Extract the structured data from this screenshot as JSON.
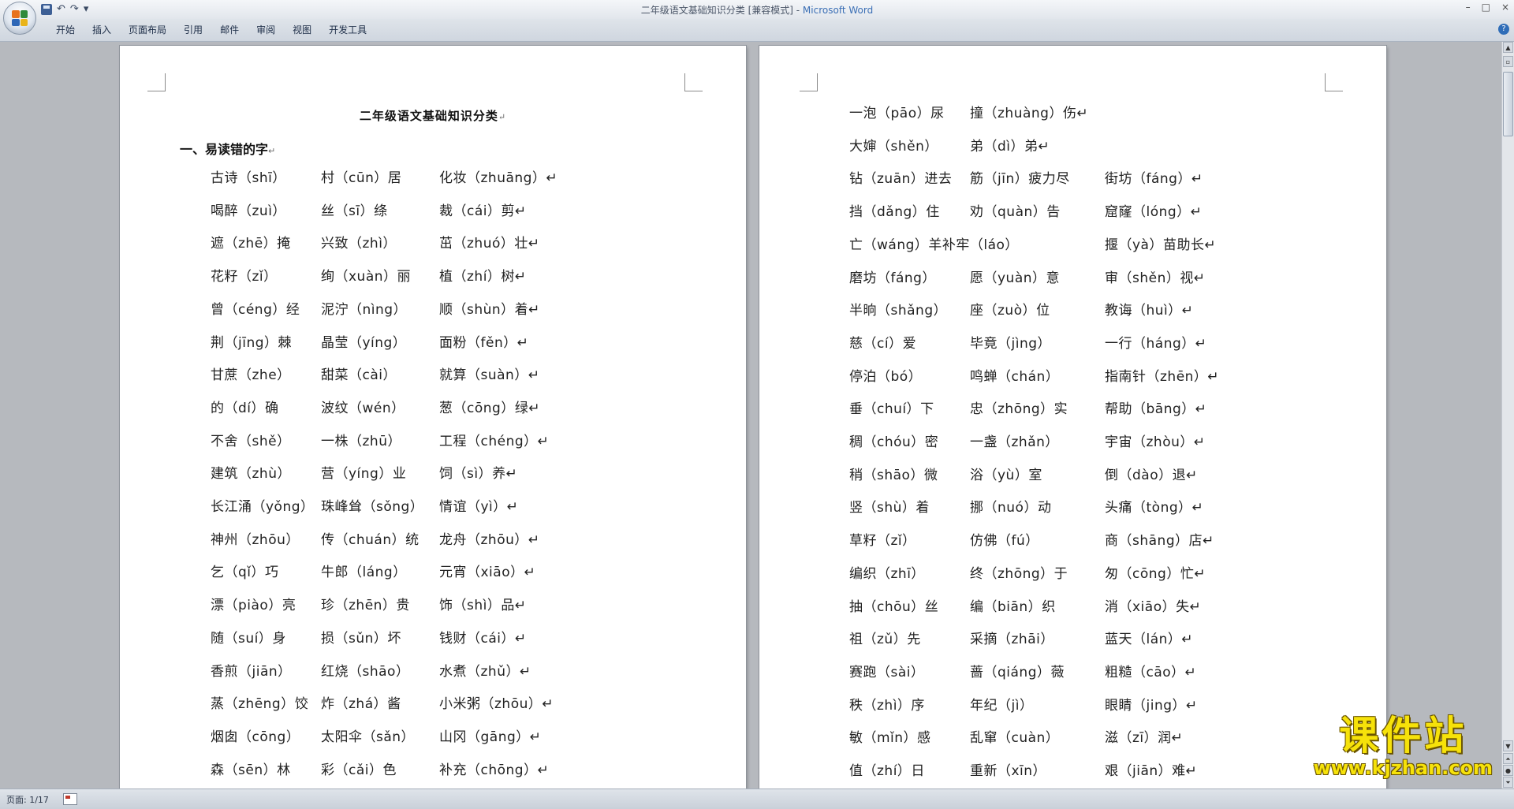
{
  "window": {
    "title": "二年级语文基础知识分类 [兼容模式] - ",
    "app_name": "Microsoft Word",
    "controls": [
      "–",
      "□",
      "×"
    ]
  },
  "quick_access": {
    "undo": "↶",
    "redo": "↷",
    "customize": "▾"
  },
  "ribbon_tabs": [
    "开始",
    "插入",
    "页面布局",
    "引用",
    "邮件",
    "审阅",
    "视图",
    "开发工具"
  ],
  "doc": {
    "title": "二年级语文基础知识分类",
    "heading": "一、易读错的字"
  },
  "left_rows": [
    [
      "古诗（shī）",
      "村（cūn）居",
      "化妆（zhuāng）↵"
    ],
    [
      "喝醉（zuì）",
      "丝（sī）绦",
      "裁（cái）剪↵"
    ],
    [
      "遮（zhē）掩",
      "兴致（zhì）",
      "茁（zhuó）壮↵"
    ],
    [
      "花籽（zǐ）",
      "绚（xuàn）丽",
      "植（zhí）树↵"
    ],
    [
      "曾（céng）经",
      "泥泞（nìng）",
      "顺（shùn）着↵"
    ],
    [
      "荆（jīng）棘",
      "晶莹（yíng）",
      "面粉（fěn）↵"
    ],
    [
      "甘蔗（zhe）",
      "甜菜（cài）",
      "就算（suàn）↵"
    ],
    [
      "的（dí）确",
      "波纹（wén）",
      "葱（cōng）绿↵"
    ],
    [
      "不舍（shě）",
      "一株（zhū）",
      "工程（chéng）↵"
    ],
    [
      "建筑（zhù）",
      "营（yíng）业",
      "饲（sì）养↵"
    ],
    [
      "长江涌（yǒng）",
      "珠峰耸（sǒng）",
      "情谊（yì）↵"
    ],
    [
      "神州（zhōu）",
      "传（chuán）统",
      "龙舟（zhōu）↵"
    ],
    [
      "乞（qǐ）巧",
      "牛郎（láng）",
      "元宵（xiāo）↵"
    ],
    [
      "漂（piào）亮",
      "珍（zhēn）贵",
      "饰（shì）品↵"
    ],
    [
      "随（suí）身",
      "损（sǔn）坏",
      "钱财（cái）↵"
    ],
    [
      "香煎（jiān）",
      "红烧（shāo）",
      "水煮（zhǔ）↵"
    ],
    [
      "蒸（zhēng）饺",
      "炸（zhá）酱",
      "小米粥（zhōu）↵"
    ],
    [
      "烟囱（cōng）",
      "太阳伞（sǎn）",
      "山冈（gāng）↵"
    ],
    [
      "森（sēn）林",
      "彩（cǎi）色",
      "补充（chōng）↵"
    ]
  ],
  "right_rows": [
    [
      "一泡（pāo）尿",
      "撞（zhuàng）伤↵",
      ""
    ],
    [
      "大婶（shěn）",
      "弟（dì）弟↵",
      ""
    ],
    [
      "钻（zuān）进去",
      "筋（jīn）疲力尽",
      "街坊（fáng）↵"
    ],
    [
      "挡（dǎng）住",
      "劝（quàn）告",
      "窟窿（lóng）↵"
    ],
    [
      "亡（wáng）羊补牢（láo）",
      "",
      "揠（yà）苗助长↵"
    ],
    [
      "磨坊（fáng）",
      "愿（yuàn）意",
      "审（shěn）视↵"
    ],
    [
      "半晌（shǎng）",
      "座（zuò）位",
      "教诲（huì）↵"
    ],
    [
      "慈（cí）爱",
      "毕竟（jìng）",
      "一行（háng）↵"
    ],
    [
      "停泊（bó）",
      "鸣蝉（chán）",
      "指南针（zhēn）↵"
    ],
    [
      "垂（chuí）下",
      "忠（zhōng）实",
      "帮助（bāng）↵"
    ],
    [
      "稠（chóu）密",
      "一盏（zhǎn）",
      "宇宙（zhòu）↵"
    ],
    [
      "稍（shāo）微",
      "浴（yù）室",
      "倒（dào）退↵"
    ],
    [
      "竖（shù）着",
      "挪（nuó）动",
      "头痛（tòng）↵"
    ],
    [
      "草籽（zǐ）",
      "仿佛（fú）",
      "商（shāng）店↵"
    ],
    [
      "编织（zhī）",
      "终（zhōng）于",
      "匆（cōng）忙↵"
    ],
    [
      "抽（chōu）丝",
      "编（biān）织",
      "消（xiāo）失↵"
    ],
    [
      "祖（zǔ）先",
      "采摘（zhāi）",
      "蓝天（lán）↵"
    ],
    [
      "赛跑（sài）",
      "蔷（qiáng）薇",
      "粗糙（cāo）↵"
    ],
    [
      "秩（zhì）序",
      "年纪（jì）",
      "眼睛（jing）↵"
    ],
    [
      "敏（mǐn）感",
      "乱窜（cuàn）",
      "滋（zī）润↵"
    ],
    [
      "值（zhí）日",
      "重新（xīn）",
      "艰（jiān）难↵"
    ]
  ],
  "status": {
    "page": "页面: 1/17"
  },
  "watermark": {
    "main": "课件站",
    "url": "www.kjzhan.com"
  }
}
